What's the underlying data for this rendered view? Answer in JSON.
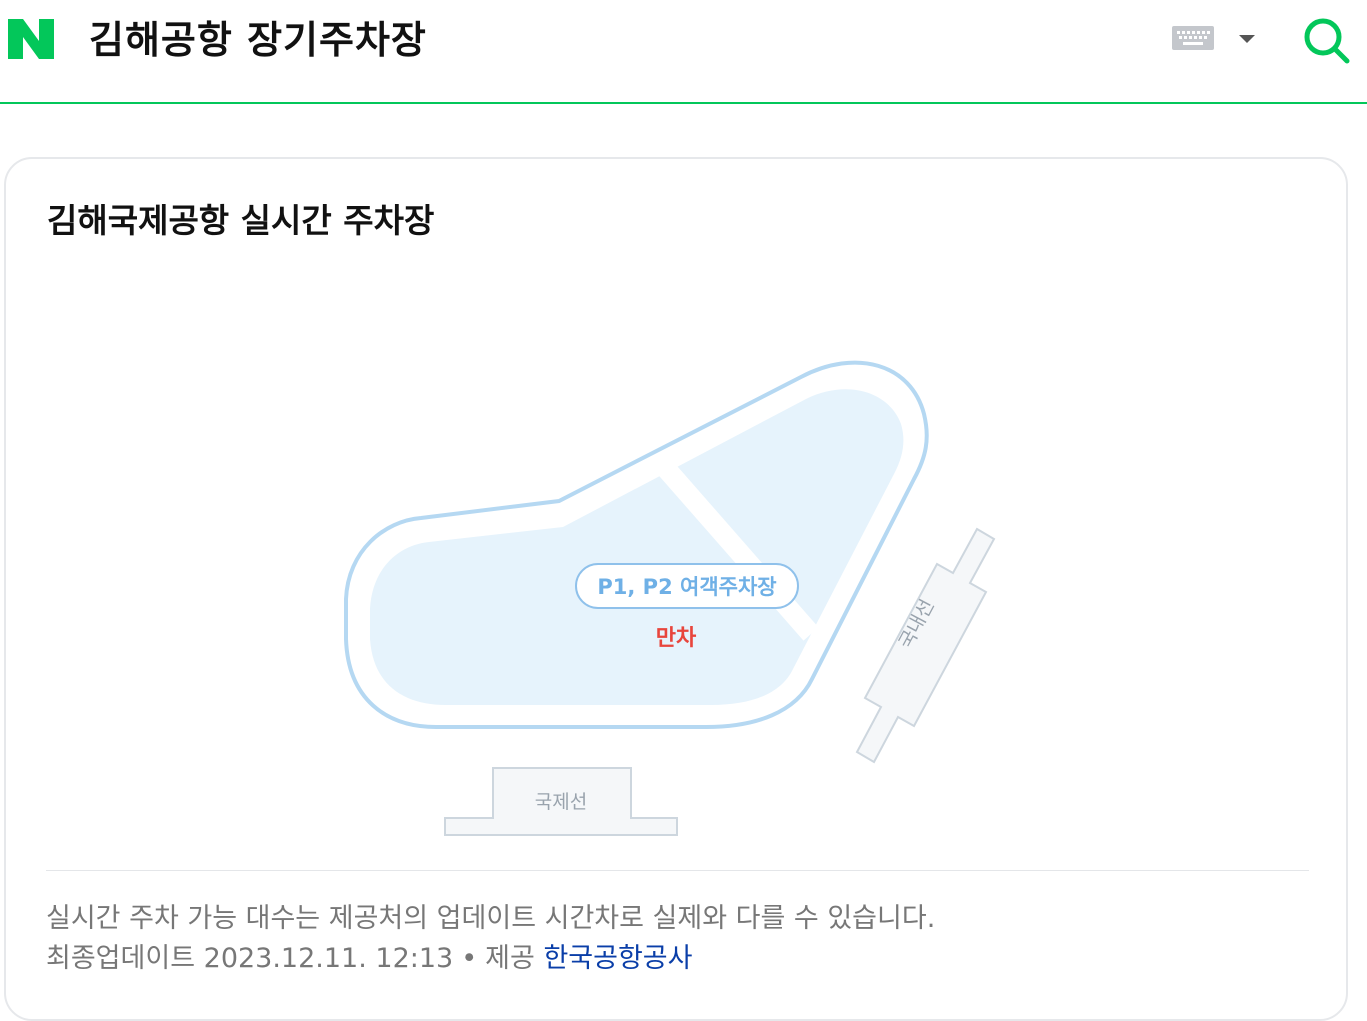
{
  "header": {
    "logo_letter": "N",
    "query": "김해공항 장기주차장",
    "brand_color": "#03c75a",
    "icons": [
      "keyboard-icon",
      "dropdown-arrow-icon",
      "search-icon"
    ]
  },
  "card": {
    "title": "김해국제공항 실시간 주차장",
    "map": {
      "lot_label": "P1, P2 여객주차장",
      "lot_status": "만차",
      "status_color": "#e8453c",
      "domestic_terminal": "국내선",
      "international_terminal": "국제선"
    },
    "notice": "실시간 주차 가능 대수는 제공처의 업데이트 시간차로 실제와 다를 수 있습니다.",
    "update_label": "최종업데이트",
    "update_time": "2023.12.11. 12:13",
    "provider_label": "제공",
    "provider_name": "한국공항공사"
  }
}
